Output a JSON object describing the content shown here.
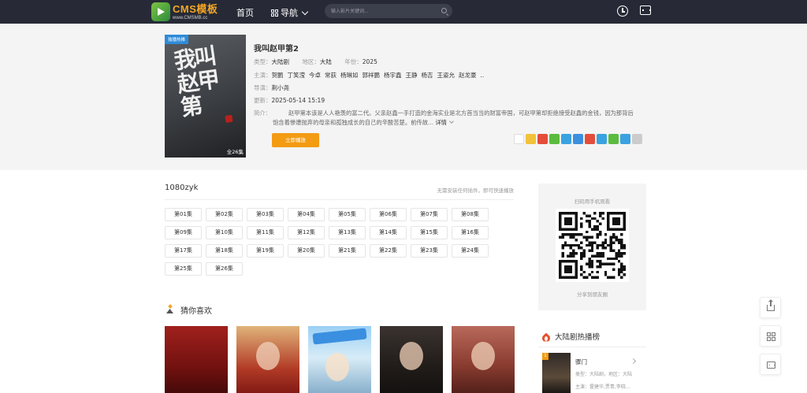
{
  "header": {
    "logo_title": "CMS模板",
    "logo_sub": "www.CMSMB.cc",
    "nav_home": "首页",
    "nav_menu": "导航",
    "search_placeholder": "输入影片关键词..."
  },
  "detail": {
    "poster_tag": "独播热推",
    "poster_art": "我叫赵甲第",
    "poster_count": "全26集",
    "title": "我叫赵甲第2",
    "type_label": "类型：",
    "type_value": "大陆剧",
    "area_label": "地区：",
    "area_value": "大陆",
    "year_label": "年份：",
    "year_value": "2025",
    "cast_label": "主演：",
    "cast": [
      "贺鹏",
      "丁笑滢",
      "今卓",
      "常荻",
      "杨琳如",
      "郭祥鹏",
      "杨宇鑫",
      "王静",
      "杨吉",
      "王姿允",
      "赵龙豪",
      ".."
    ],
    "director_label": "导演：",
    "director_value": "荆小尧",
    "update_label": "更新：",
    "update_value": "2025-05-14 15:19",
    "intro_label": "简介：",
    "intro_text": "赵甲第本该是人人艳羡的富二代。父亲赵鑫一手打造的金海实业是北方首当当的财富帝国，可赵甲第却拒绝接受赵鑫的金钱，因为那背后饱含着惨遭抛弃的母亲和孤独成长的自己的辛酸苦楚。前传故...",
    "intro_more": "详情",
    "play_button": "立即播放",
    "share_colors": [
      "#ffffff",
      "#f2c23a",
      "#e44d3a",
      "#5bbb3f",
      "#3aa2e0",
      "#3d8fe0",
      "#e44d3a",
      "#3aa2e0",
      "#5bbb3f",
      "#3aa2e0",
      "#cccccc"
    ]
  },
  "playlist": {
    "source": "1080zyk",
    "tip": "无需安装任何插件，即可快速播放",
    "episodes": [
      "第01集",
      "第02集",
      "第03集",
      "第04集",
      "第05集",
      "第06集",
      "第07集",
      "第08集",
      "第09集",
      "第10集",
      "第11集",
      "第12集",
      "第13集",
      "第14集",
      "第15集",
      "第16集",
      "第17集",
      "第18集",
      "第19集",
      "第20集",
      "第21集",
      "第22集",
      "第23集",
      "第24集",
      "第25集",
      "第26集"
    ]
  },
  "guess": {
    "title": "猜你喜欢"
  },
  "qr": {
    "title": "扫码用手机观看",
    "caption": "分享到朋友圈"
  },
  "hot": {
    "title": "大陆剧热播榜",
    "items": [
      {
        "rank": "1",
        "name": "骤门",
        "meta": "类型：大陆剧，地区：大陆",
        "cast": "主演：霍建华,贾青,李晓..."
      }
    ]
  }
}
